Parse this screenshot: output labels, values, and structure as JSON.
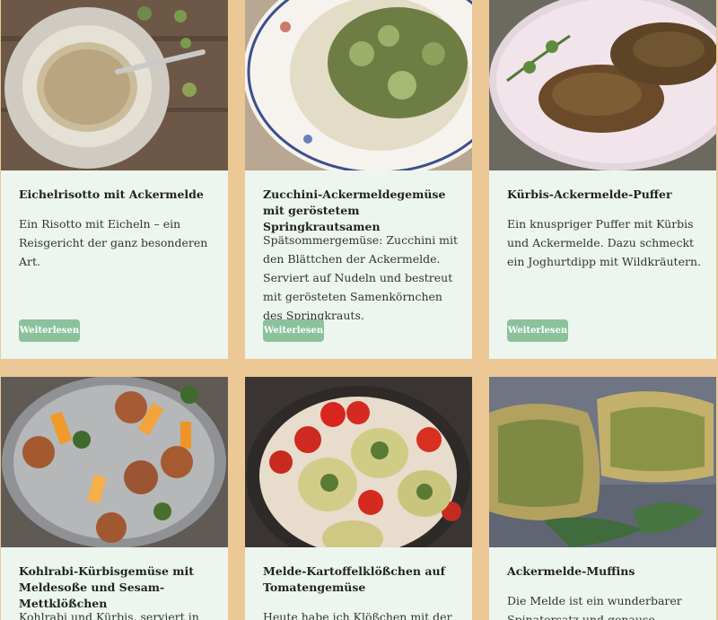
{
  "recipes": [
    {
      "title": "Eichelrisotto mit Ackermelde",
      "description": "Ein Risotto mit Eicheln – ein Reisgericht der ganz besonderen Art.",
      "button": "Weiterlesen",
      "image_icon": "risotto-image"
    },
    {
      "title": "Zucchini-Ackermeldegemüse mit geröstetem Springkrautsamen",
      "description": "Spätsommergemüse: Zucchini mit den Blättchen der Ackermelde. Serviert auf Nudeln und bestreut mit gerösteten Samenkörnchen des Springkrauts.",
      "button": "Weiterlesen",
      "image_icon": "zucchini-image"
    },
    {
      "title": "Kürbis-Ackermelde-Puffer",
      "description": "Ein knuspriger Puffer mit Kürbis und Ackermelde. Dazu schmeckt ein Joghurtdipp mit Wildkräutern.",
      "button": "Weiterlesen",
      "image_icon": "puffer-image"
    },
    {
      "title": "Kohlrabi-Kürbisgemüse mit Meldesoße und Sesam-Mettklößchen",
      "description": "Kohlrabi und Kürbis, serviert in einer",
      "button": "",
      "image_icon": "kohlrabi-image"
    },
    {
      "title": "Melde-Kartoffelklößchen auf Tomatengemüse",
      "description": "Heute habe ich Klößchen mit der",
      "button": "",
      "image_icon": "kloesschen-image"
    },
    {
      "title": "Ackermelde-Muffins",
      "description": "Die Melde ist ein wunderbarer Spinatersatz und genauso vielfältig",
      "button": "",
      "image_icon": "muffins-image"
    }
  ],
  "colors": {
    "background": "#ecc897",
    "card": "#edf5ef",
    "button": "#8bc19b"
  }
}
